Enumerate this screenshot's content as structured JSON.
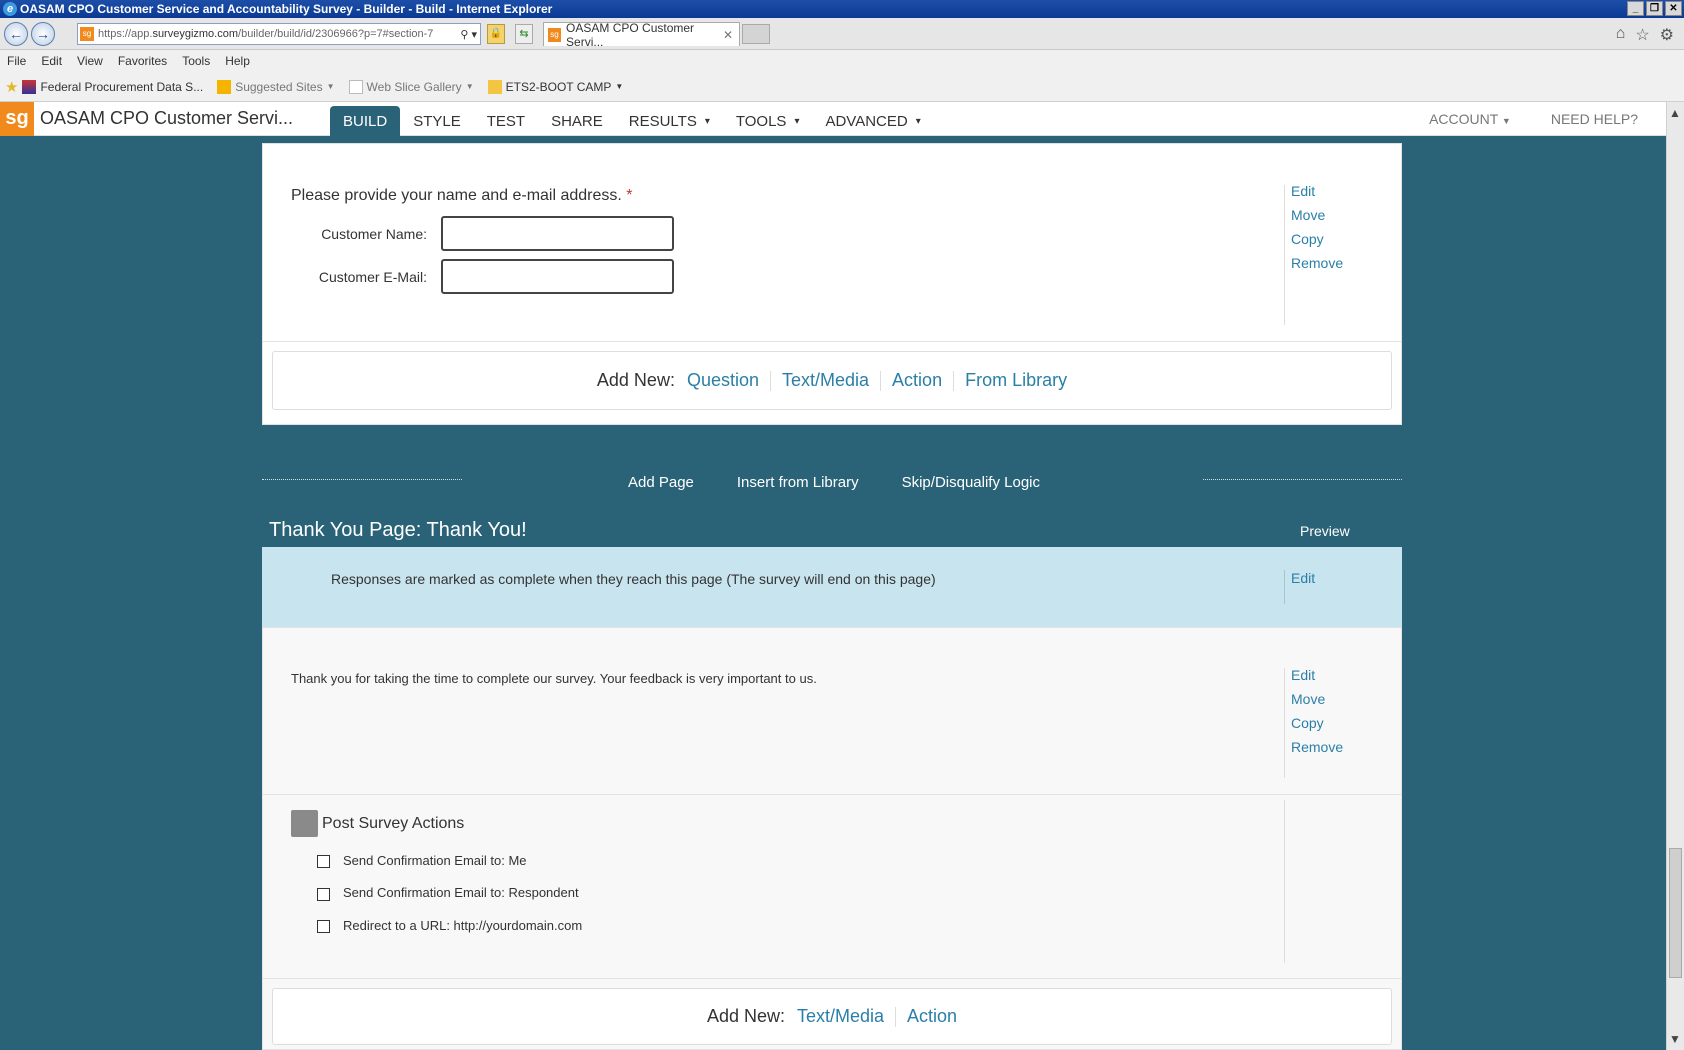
{
  "window": {
    "title": "OASAM CPO Customer Service and Accountability Survey - Builder - Build - Internet Explorer",
    "controls": [
      "_",
      "❐",
      "✕"
    ]
  },
  "browser": {
    "url_prefix": "https://app.",
    "url_domain": "surveygizmo.com",
    "url_rest": "/builder/build/id/2306966?p=7#section-7",
    "tab_title": "OASAM CPO Customer Servi...",
    "menu": [
      "File",
      "Edit",
      "View",
      "Favorites",
      "Tools",
      "Help"
    ],
    "favorites": [
      {
        "label": "Federal Procurement Data S...",
        "icon": "fpds-icon"
      },
      {
        "label": "Suggested Sites",
        "icon": "bing-icon",
        "dropdown": true
      },
      {
        "label": "Web Slice Gallery",
        "icon": "webslice-icon",
        "dropdown": true
      },
      {
        "label": "ETS2-BOOT CAMP",
        "icon": "folder-icon",
        "dropdown": true
      }
    ]
  },
  "app": {
    "logo": "sg",
    "title": "OASAM CPO Customer Servi...",
    "nav": [
      {
        "label": "BUILD",
        "active": true
      },
      {
        "label": "STYLE"
      },
      {
        "label": "TEST"
      },
      {
        "label": "SHARE"
      },
      {
        "label": "RESULTS",
        "dropdown": true
      },
      {
        "label": "TOOLS",
        "dropdown": true
      },
      {
        "label": "ADVANCED",
        "dropdown": true
      }
    ],
    "account": "ACCOUNT",
    "help": "NEED HELP?"
  },
  "question": {
    "title": "Please provide your name and e-mail address.",
    "required_mark": "*",
    "fields": [
      {
        "label": "Customer Name:",
        "value": ""
      },
      {
        "label": "Customer E-Mail:",
        "value": ""
      }
    ],
    "actions": [
      "Edit",
      "Move",
      "Copy",
      "Remove"
    ]
  },
  "add_new_1": {
    "label": "Add New:",
    "links": [
      "Question",
      "Text/Media",
      "Action",
      "From Library"
    ]
  },
  "page_tools": [
    "Add Page",
    "Insert from Library",
    "Skip/Disqualify Logic"
  ],
  "thank_you_page": {
    "title": "Thank You Page: Thank You!",
    "preview": "Preview",
    "info": "Responses are marked as complete when they reach this page (The survey will end on this page)",
    "info_action": "Edit",
    "text": "Thank you for taking the time to complete our survey. Your feedback is very important to us.",
    "text_actions": [
      "Edit",
      "Move",
      "Copy",
      "Remove"
    ],
    "post_actions_title": "Post Survey Actions",
    "post_actions": [
      {
        "label": "Send Confirmation Email to: Me",
        "checked": false
      },
      {
        "label": "Send Confirmation Email to: Respondent",
        "checked": false
      },
      {
        "label": "Redirect to a URL: http://yourdomain.com",
        "checked": false
      }
    ]
  },
  "add_new_2": {
    "label": "Add New:",
    "links": [
      "Text/Media",
      "Action"
    ]
  },
  "colors": {
    "background": "#2a6377",
    "accent": "#f08a1d",
    "link": "#2a7fa8",
    "info_bg": "#c8e4ee"
  }
}
